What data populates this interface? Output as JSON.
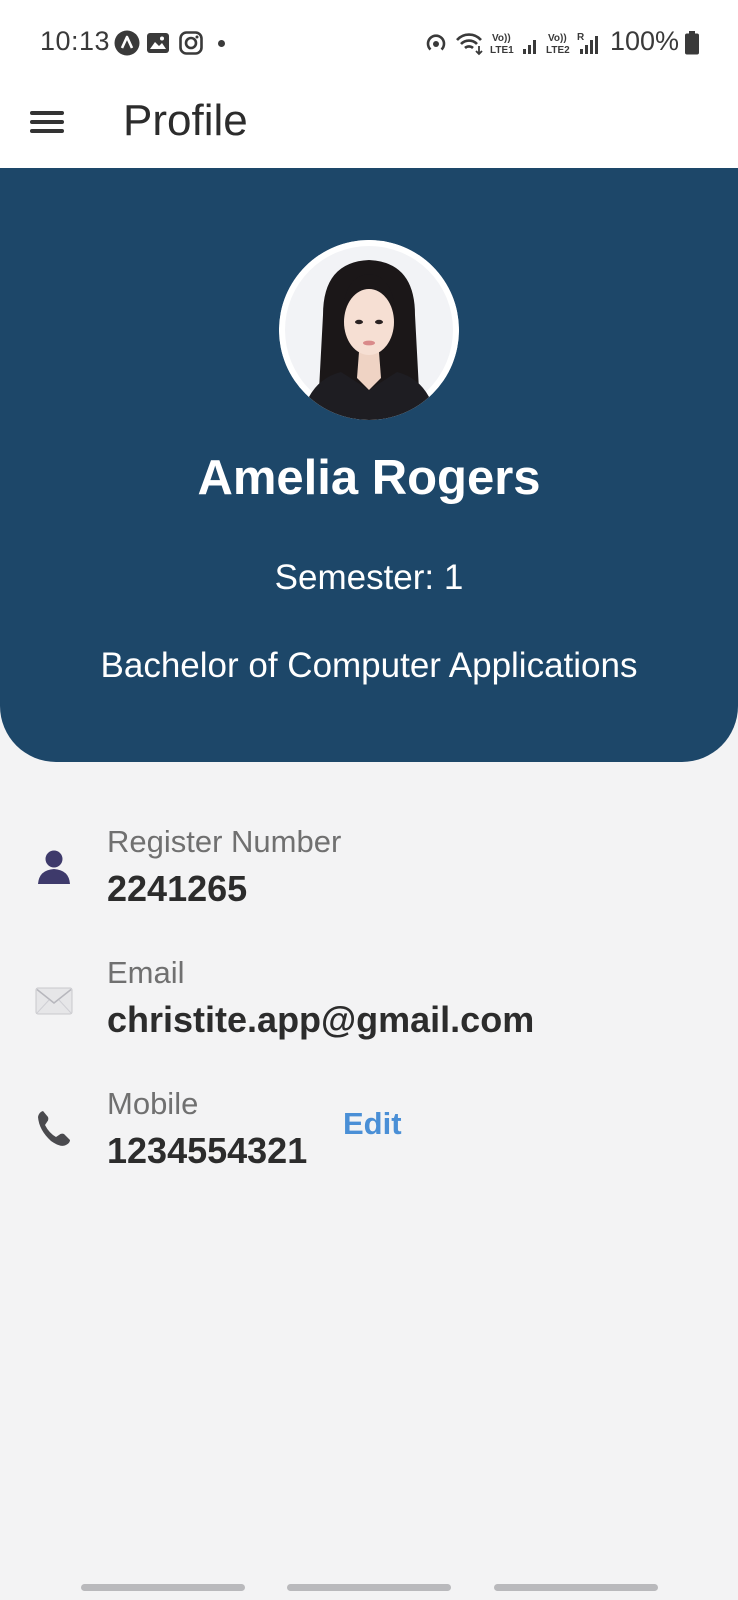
{
  "status_bar": {
    "time": "10:13",
    "battery": "100%",
    "icons": [
      "a-circle-icon",
      "image-icon",
      "instagram-icon",
      "hotspot-icon",
      "wifi-icon",
      "signal-lte1-icon",
      "signal-lte2-icon",
      "battery-icon"
    ]
  },
  "app_bar": {
    "title": "Profile"
  },
  "profile": {
    "name": "Amelia Rogers",
    "semester": "Semester: 1",
    "course": "Bachelor of Computer Applications"
  },
  "details": {
    "register": {
      "label": "Register Number",
      "value": "2241265"
    },
    "email": {
      "label": "Email",
      "value": "christite.app@gmail.com"
    },
    "mobile": {
      "label": "Mobile",
      "value": "1234554321",
      "edit_label": "Edit"
    }
  },
  "colors": {
    "header_bg": "#1d4769",
    "page_bg": "#f3f3f4",
    "link": "#4a8fd6"
  }
}
